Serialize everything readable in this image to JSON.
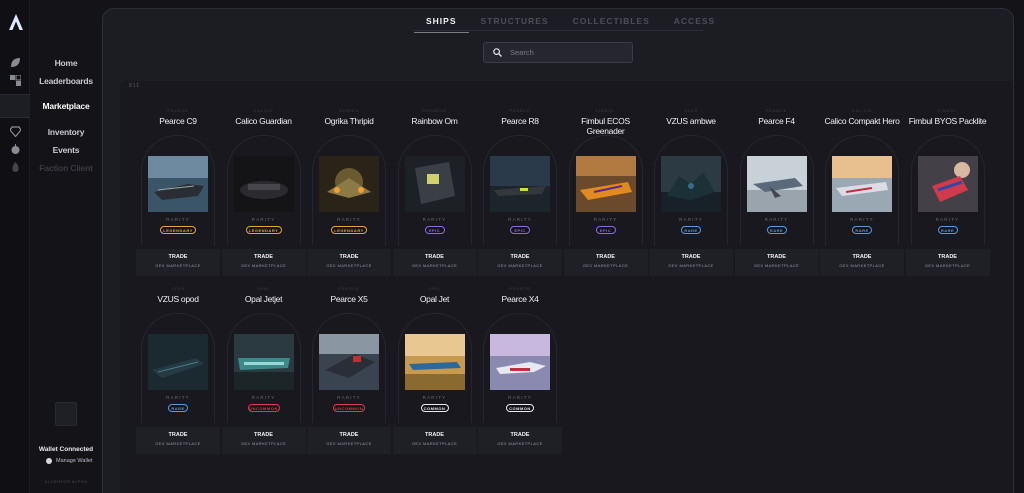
{
  "colors": {
    "legendary": "#e6a53a",
    "epic": "#8f69e8",
    "rare": "#4f9ee8",
    "uncommon": "#e03a4c",
    "common": "#e9e9ee",
    "panel": "#1c1c23",
    "accent_logo": "#dfe8ff"
  },
  "nav": {
    "items": [
      {
        "label": "Home",
        "icon": "leaf-icon"
      },
      {
        "label": "Leaderboards",
        "icon": "users-icon"
      },
      {
        "label": "Marketplace",
        "icon": "cart-icon"
      },
      {
        "label": "Inventory",
        "icon": "diamond-icon"
      },
      {
        "label": "Events",
        "icon": "rebel-icon"
      },
      {
        "label": "Faction Client",
        "icon": "flame-icon"
      }
    ],
    "wallet_status": "Wallet Connected",
    "manage_wallet": "Manage Wallet",
    "footer": "ALCEHTOR ALPHA"
  },
  "tabs": [
    {
      "label": "SHIPS",
      "active": true
    },
    {
      "label": "STRUCTURES",
      "active": false
    },
    {
      "label": "COLLECTIBLES",
      "active": false
    },
    {
      "label": "ACCESS",
      "active": false
    }
  ],
  "search": {
    "placeholder": "Search"
  },
  "content_label": "811",
  "rarity_label": "RARITY",
  "trade_label": "TRADE",
  "trade_sub": "GEX MARKETPLACE",
  "cards": [
    {
      "name": "Pearce C9",
      "sub": "PEARCE",
      "rarity": "LEGENDARY",
      "kind": "legendary",
      "img": "a"
    },
    {
      "name": "Calico Guardian",
      "sub": "CALICO",
      "rarity": "LEGENDARY",
      "kind": "legendary",
      "img": "b"
    },
    {
      "name": "Ogrika Thripid",
      "sub": "OGRIKA",
      "rarity": "LEGENDARY",
      "kind": "legendary",
      "img": "c"
    },
    {
      "name": "Rainbow Om",
      "sub": "RAINBOW",
      "rarity": "EPIC",
      "kind": "epic",
      "img": "d"
    },
    {
      "name": "Pearce R8",
      "sub": "PEARCE",
      "rarity": "EPIC",
      "kind": "epic",
      "img": "e"
    },
    {
      "name": "Fimbul ECOS Greenader",
      "sub": "FIMBUL",
      "rarity": "EPIC",
      "kind": "epic",
      "img": "f"
    },
    {
      "name": "VZUS ambwe",
      "sub": "VZUS",
      "rarity": "RARE",
      "kind": "rare",
      "img": "g"
    },
    {
      "name": "Pearce F4",
      "sub": "PEARCE",
      "rarity": "RARE",
      "kind": "rare",
      "img": "h"
    },
    {
      "name": "Calico Compakt Hero",
      "sub": "CALICO",
      "rarity": "RARE",
      "kind": "rare",
      "img": "i"
    },
    {
      "name": "Fimbul BYOS Packlite",
      "sub": "FIMBUL",
      "rarity": "RARE",
      "kind": "rare",
      "img": "j"
    },
    {
      "name": "VZUS opod",
      "sub": "VZUS",
      "rarity": "RARE",
      "kind": "rare",
      "img": "k"
    },
    {
      "name": "Opal Jetjet",
      "sub": "OPAL",
      "rarity": "UNCOMMON",
      "kind": "uncommon",
      "img": "l"
    },
    {
      "name": "Pearce X5",
      "sub": "PEARCE",
      "rarity": "UNCOMMON",
      "kind": "uncommon",
      "img": "m"
    },
    {
      "name": "Opal Jet",
      "sub": "OPAL",
      "rarity": "COMMON",
      "kind": "common",
      "img": "n"
    },
    {
      "name": "Pearce X4",
      "sub": "PEARCE",
      "rarity": "COMMON",
      "kind": "common",
      "img": "o"
    }
  ]
}
